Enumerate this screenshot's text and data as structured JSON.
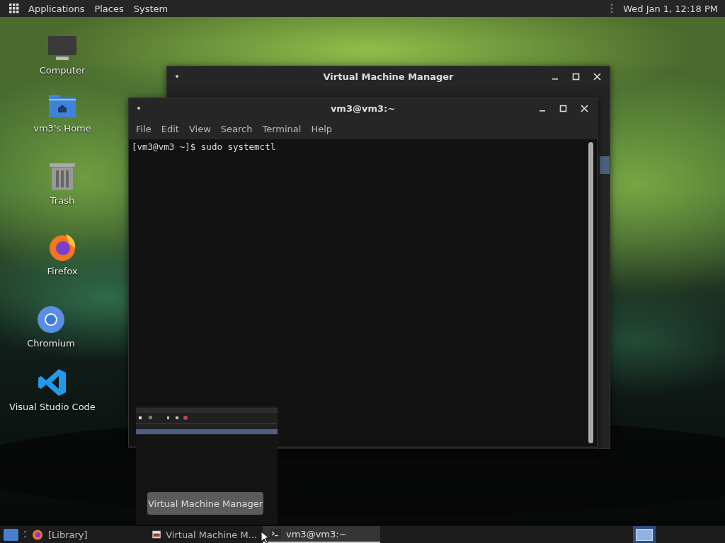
{
  "top_panel": {
    "menus": [
      "Applications",
      "Places",
      "System"
    ],
    "clock": "Wed Jan 1, 12:18 PM"
  },
  "desktop_icons": [
    {
      "kind": "computer",
      "label": "Computer"
    },
    {
      "kind": "home",
      "label": "vm3's Home"
    },
    {
      "kind": "trash",
      "label": "Trash"
    },
    {
      "kind": "firefox",
      "label": "Firefox"
    },
    {
      "kind": "chromium",
      "label": "Chromium"
    },
    {
      "kind": "vscode",
      "label": "Visual Studio Code"
    }
  ],
  "windows": [
    {
      "kind": "vmm",
      "title": "Virtual Machine Manager"
    },
    {
      "kind": "terminal",
      "title": "vm3@vm3:~",
      "menus": [
        "File",
        "Edit",
        "View",
        "Search",
        "Terminal",
        "Help"
      ],
      "lines": [
        "[vm3@vm3 ~]$ sudo systemctl"
      ]
    }
  ],
  "preview": {
    "tooltip": "Virtual Machine Manager"
  },
  "taskbar": {
    "items": [
      {
        "kind": "firefox",
        "label": "[Library]",
        "selected": false
      },
      {
        "kind": "vmm",
        "label": "Virtual Machine M...",
        "selected": false
      },
      {
        "kind": "terminal",
        "label": "vm3@vm3:~",
        "selected": true
      }
    ]
  }
}
